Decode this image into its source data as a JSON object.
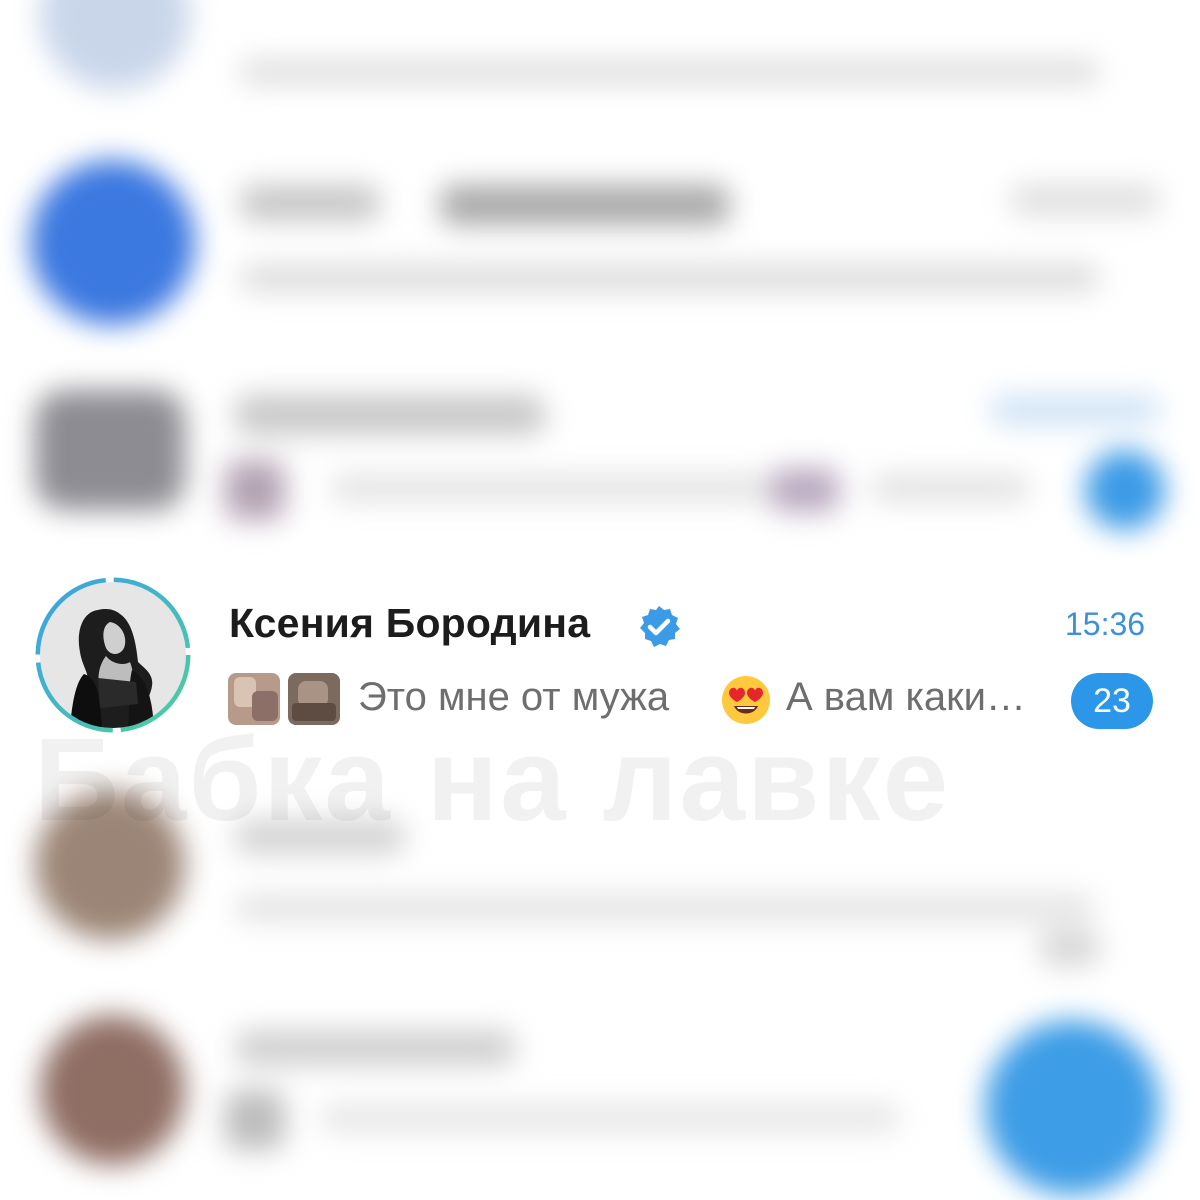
{
  "chat": {
    "name": "Ксения Бородина",
    "time": "15:36",
    "preview_text": "Это мне от мужа",
    "preview_text_after_emoji": "А вам каки…",
    "emoji": "heart-eyes-emoji",
    "unread_count": "23"
  },
  "watermark": "Бабка на лавке",
  "colors": {
    "accent": "#3f8fd9",
    "badge": "#2c97e8",
    "verified": "#3c9be6",
    "story_ring_start": "#3aa0e8",
    "story_ring_end": "#4fcf9a"
  }
}
